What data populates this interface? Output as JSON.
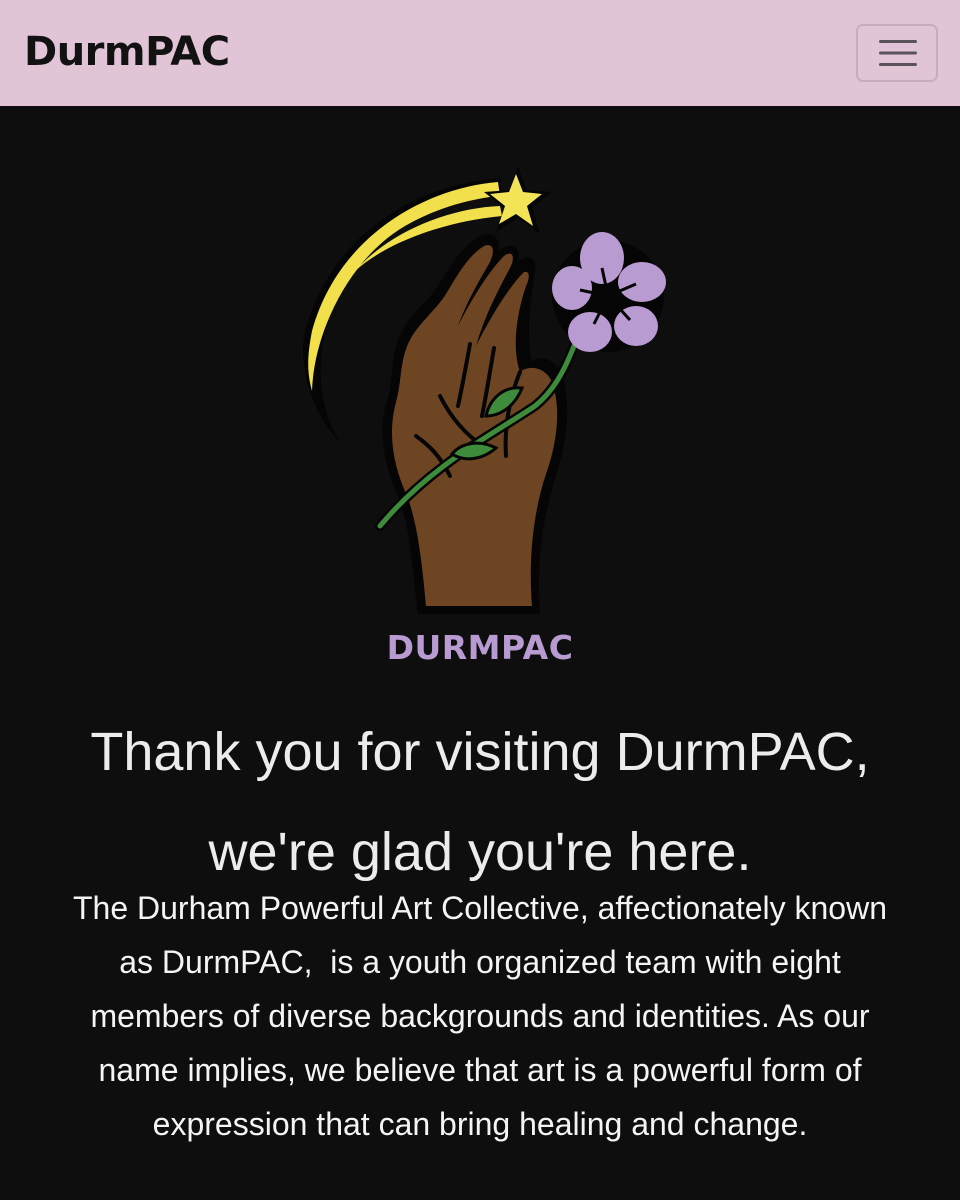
{
  "navbar": {
    "brand": "DurmPAC",
    "menu_icon": "hamburger-menu-icon",
    "background_color": "#e1c5d6"
  },
  "hero": {
    "logo": {
      "image": "hand-holding-flower-shooting-star-logo",
      "wordmark": "DURMPAC",
      "wordmark_color": "#b89bd0"
    },
    "headline_lines": [
      "Thank you for visiting DurmPAC,",
      "we're glad you're here."
    ],
    "about_lines": [
      "The Durham Powerful Art Collective, affectionately known",
      "as DurmPAC,  is a youth organized team with eight",
      "members of diverse backgrounds and identities. As our",
      "name implies, we believe that art is a powerful form of",
      "expression that can bring healing and change."
    ],
    "background_color": "#0e0e0e"
  }
}
